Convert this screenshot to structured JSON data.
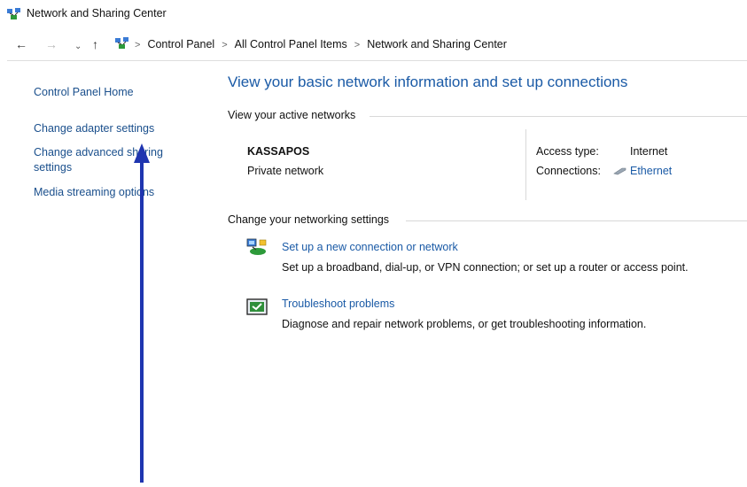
{
  "window": {
    "title": "Network and Sharing Center",
    "icon": "network-center-icon"
  },
  "address_bar": {
    "back": "←",
    "forward": "→",
    "recent": "⌄",
    "up": "↑",
    "breadcrumbs": [
      "Control Panel",
      "All Control Panel Items",
      "Network and Sharing Center"
    ],
    "separator": ">"
  },
  "sidebar": {
    "items": [
      {
        "label": "Control Panel Home"
      },
      {
        "label": "Change adapter settings"
      },
      {
        "label_line1": "Change advanced sharing",
        "label_line2": "settings"
      },
      {
        "label": "Media streaming options"
      }
    ]
  },
  "main": {
    "heading": "View your basic network information and set up connections",
    "active_networks": {
      "label": "View your active networks",
      "name": "KASSAPOS",
      "type": "Private network",
      "access_type_label": "Access type:",
      "access_type_value": "Internet",
      "connections_label": "Connections:",
      "connections_value": "Ethernet",
      "connection_icon": "ethernet-icon"
    },
    "settings": {
      "label": "Change your networking settings",
      "tasks": [
        {
          "title": "Set up a new connection or network",
          "description": "Set up a broadband, dial-up, or VPN connection; or set up a router or access point.",
          "icon": "new-connection-icon"
        },
        {
          "title": "Troubleshoot problems",
          "description": "Diagnose and repair network problems, or get troubleshooting information.",
          "icon": "troubleshoot-icon"
        }
      ]
    }
  },
  "annotation": {
    "icon": "pointer-arrow-icon",
    "color": "#1f35b0"
  },
  "colors": {
    "link": "#1a5aa6",
    "heading": "#1a5aa6",
    "sidebar_link": "#1a4f8c"
  }
}
